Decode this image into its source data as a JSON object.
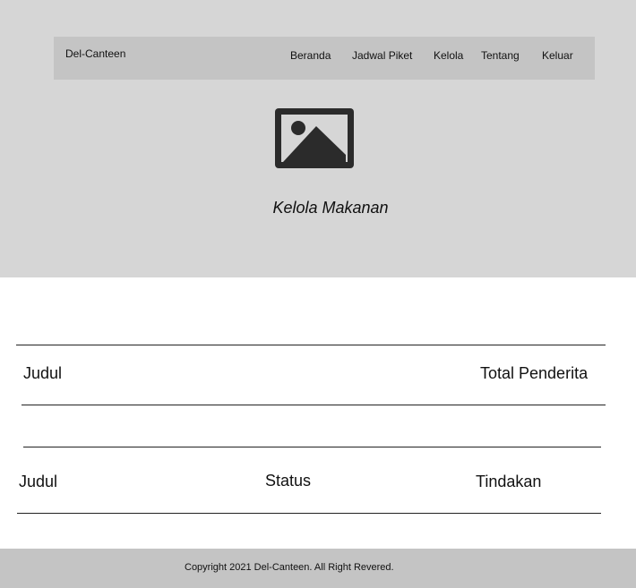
{
  "header": {
    "brand": "Del-Canteen",
    "nav": [
      "Beranda",
      "Jadwal Piket",
      "Kelola",
      "Tentang",
      "Keluar"
    ]
  },
  "hero": {
    "image_icon": "image-placeholder-icon",
    "title": "Kelola Makanan"
  },
  "tables": [
    {
      "headers": [
        "Judul",
        "Total Penderita"
      ]
    },
    {
      "headers": [
        "Judul",
        "Status",
        "Tindakan"
      ]
    }
  ],
  "footer": {
    "copyright": "Copyright 2021 Del-Canteen. All Right Revered."
  },
  "colors": {
    "hero_background": "#d6d6d6",
    "navbar_background": "#c4c4c4",
    "footer_background": "#c4c4c4",
    "icon": "#2b2b2b"
  }
}
